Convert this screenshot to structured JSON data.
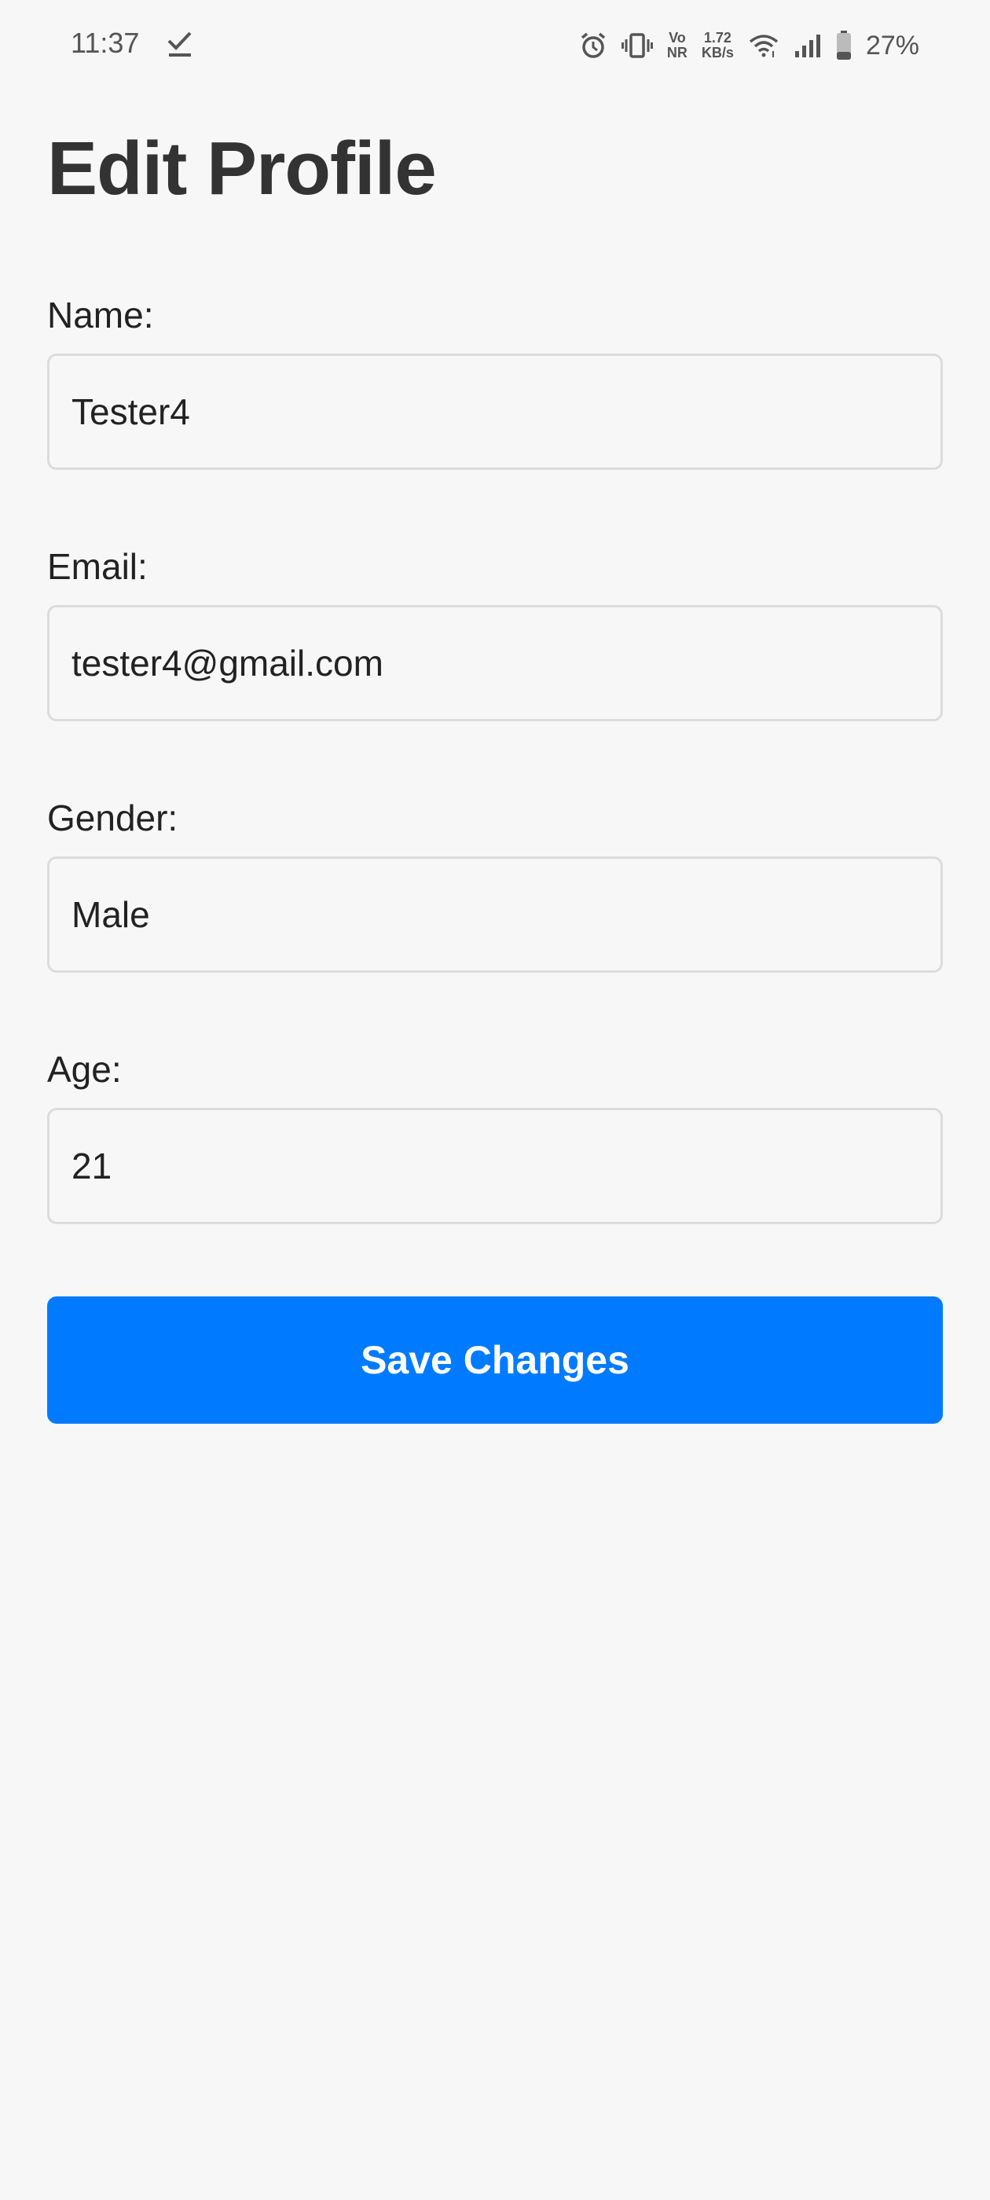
{
  "status_bar": {
    "time": "11:37",
    "check_icon": "checkmark-download-icon",
    "icons": [
      "alarm-icon",
      "vibrate-icon",
      "vonr-icon",
      "net-speed-icon",
      "wifi-icon",
      "signal-icon",
      "battery-icon"
    ],
    "vonr_top": "Vo",
    "vonr_bottom": "NR",
    "net_speed_value": "1.72",
    "net_speed_unit": "KB/s",
    "battery_percent": "27%"
  },
  "page": {
    "title": "Edit Profile"
  },
  "form": {
    "name": {
      "label": "Name:",
      "value": "Tester4"
    },
    "email": {
      "label": "Email:",
      "value": "tester4@gmail.com"
    },
    "gender": {
      "label": "Gender:",
      "value": "Male"
    },
    "age": {
      "label": "Age:",
      "value": "21"
    }
  },
  "actions": {
    "save_label": "Save Changes"
  },
  "colors": {
    "accent": "#007bff",
    "background": "#f7f7f7",
    "title": "#333333",
    "input_border": "#dcdcdc"
  }
}
